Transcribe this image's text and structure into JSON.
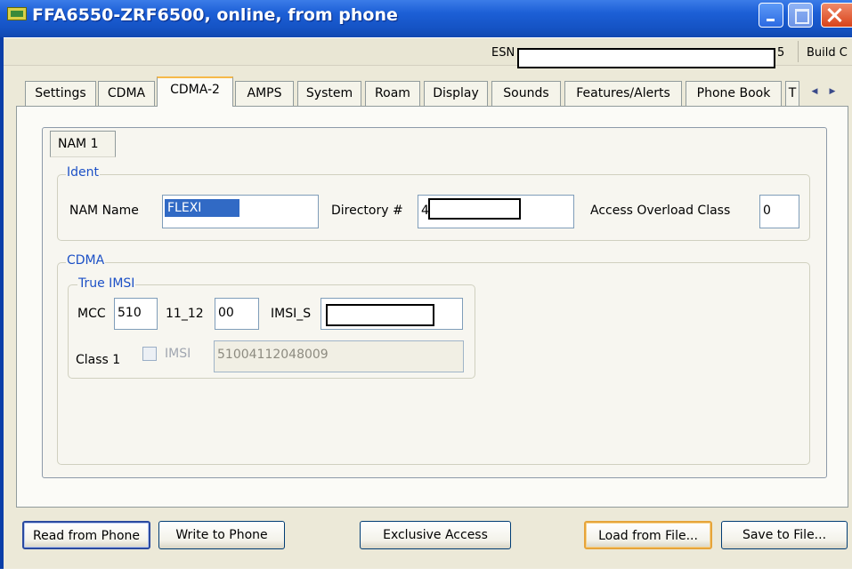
{
  "window": {
    "title": "FFA6550-ZRF6500, online, from phone"
  },
  "status": {
    "esn_label": "ESN",
    "esn_suffix": "5",
    "build_label": "Build C"
  },
  "tabs": [
    {
      "label": "Settings"
    },
    {
      "label": "CDMA"
    },
    {
      "label": "CDMA-2",
      "active": true
    },
    {
      "label": "AMPS"
    },
    {
      "label": "System"
    },
    {
      "label": "Roam"
    },
    {
      "label": "Display"
    },
    {
      "label": "Sounds"
    },
    {
      "label": "Features/Alerts"
    },
    {
      "label": "Phone Book"
    },
    {
      "label": "T"
    }
  ],
  "nam": {
    "tab_label": "NAM 1",
    "ident": {
      "group_label": "Ident",
      "nam_name_label": "NAM Name",
      "nam_name_value": "FLEXI",
      "directory_label": "Directory #",
      "directory_value": "4",
      "aoc_label": "Access Overload Class",
      "aoc_value": "0"
    },
    "cdma": {
      "group_label": "CDMA",
      "true_imsi_label": "True IMSI",
      "mcc_label": "MCC",
      "mcc_value": "510",
      "mnc_label": "11_12",
      "mnc_value": "00",
      "imsi_s_label": "IMSI_S",
      "class1_label": "Class 1",
      "imsi_check_label": "IMSI",
      "imsi_value": "51004112048009"
    }
  },
  "buttons": {
    "read": "Read from Phone",
    "write": "Write to Phone",
    "exclusive": "Exclusive Access",
    "load": "Load from File...",
    "save": "Save to File..."
  },
  "colors": {
    "titlebar": "#1c5fd6",
    "window_bg": "#ece9d8",
    "group_title": "#1c50c6",
    "active_tab_accent": "#f6b94a",
    "selection": "#316ac5"
  }
}
